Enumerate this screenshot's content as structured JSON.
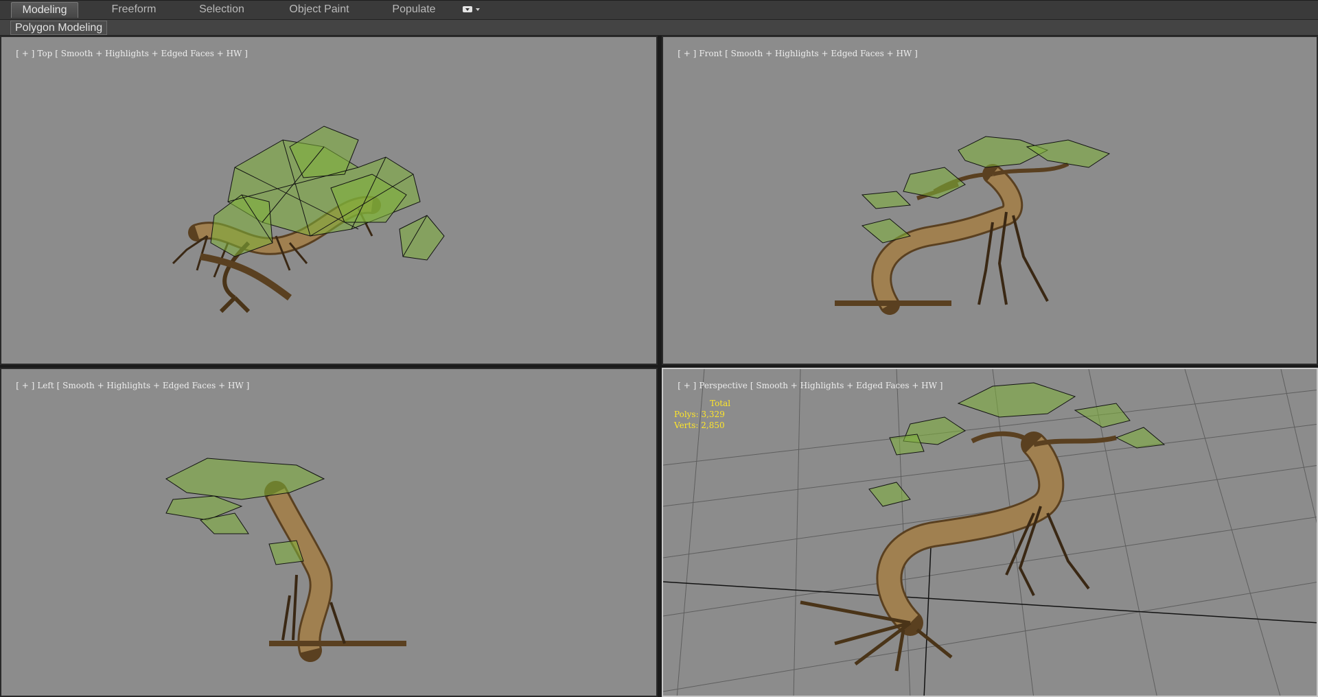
{
  "ribbon": {
    "tabs": [
      {
        "label": "Modeling",
        "active": true
      },
      {
        "label": "Freeform",
        "active": false
      },
      {
        "label": "Selection",
        "active": false
      },
      {
        "label": "Object Paint",
        "active": false
      },
      {
        "label": "Populate",
        "active": false
      }
    ],
    "options_icon": "ribbon-options-icon",
    "panel_button": "Polygon Modeling"
  },
  "viewports": {
    "top": {
      "plus": "[ + ]",
      "name": "Top",
      "shading": "[ Smooth + Highlights + Edged Faces + HW ]"
    },
    "front": {
      "plus": "[ + ]",
      "name": "Front",
      "shading": "[ Smooth + Highlights + Edged Faces + HW ]"
    },
    "left": {
      "plus": "[ + ]",
      "name": "Left",
      "shading": "[ Smooth + Highlights + Edged Faces + HW ]"
    },
    "perspective": {
      "plus": "[ + ]",
      "name": "Perspective",
      "shading": "[ Smooth + Highlights + Edged Faces + HW ]"
    }
  },
  "stats": {
    "header": "Total",
    "polys_label": "Polys:",
    "polys_value": "3,329",
    "verts_label": "Verts:",
    "verts_value": "2,850"
  },
  "colors": {
    "viewport_bg": "#8c8c8c",
    "stats_text": "#ffe629",
    "bark": "#8a6a3a",
    "foliage": "#7fb23a"
  }
}
